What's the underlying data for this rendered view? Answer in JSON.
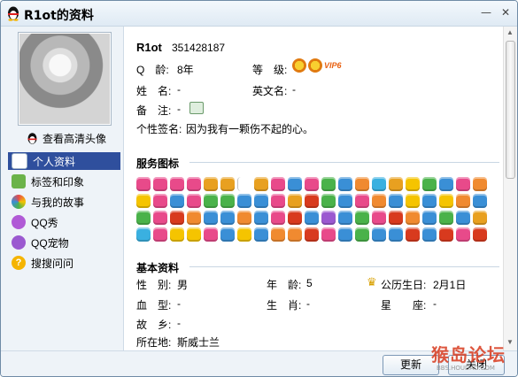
{
  "window": {
    "title": "R1ot的资料",
    "controls": [
      "—",
      "✕"
    ]
  },
  "sidebar": {
    "hd_avatar_link": "查看高清头像",
    "items": [
      {
        "label": "个人资料",
        "icon": "profile-card-icon",
        "color": "#ffffff",
        "active": true
      },
      {
        "label": "标签和印象",
        "icon": "tag-icon",
        "color": "#6bb34a",
        "active": false
      },
      {
        "label": "与我的故事",
        "icon": "rainbow-icon",
        "color": "#f0a020",
        "active": false
      },
      {
        "label": "QQ秀",
        "icon": "qq-show-icon",
        "color": "#b05ad6",
        "active": false
      },
      {
        "label": "QQ宠物",
        "icon": "qq-pet-icon",
        "color": "#9b59d0",
        "active": false
      },
      {
        "label": "搜搜问问",
        "icon": "question-icon",
        "color": "#f5b400",
        "active": false
      }
    ]
  },
  "profile": {
    "nickname": "R1ot",
    "qq_number": "351428187",
    "qq_age_label": "Q　龄:",
    "qq_age_value": "8年",
    "level_label": "等　级:",
    "level_badge": "VIP6",
    "name_label": "姓　名:",
    "name_value": "-",
    "english_name_label": "英文名:",
    "english_name_value": "-",
    "remark_label": "备　注:",
    "remark_value": "-",
    "signature_label": "个性签名:",
    "signature_value": "因为我有一颗伤不起的心。"
  },
  "services": {
    "title": "服务图标",
    "icon_colors": [
      "#e84a8a",
      "#e84a8a",
      "#e84a8a",
      "#e84a8a",
      "#e8a020",
      "#e8a020",
      "#ffffff",
      "#e8a020",
      "#e84a8a",
      "#3a8fd6",
      "#e84a8a",
      "#4ab24a",
      "#3a8fd6",
      "#f08a30",
      "#3ab0e0",
      "#e8a020",
      "#f5c400",
      "#4ab24a",
      "#3a8fd6",
      "#e84a8a",
      "#f08a30",
      "#f5c400",
      "#e84a8a",
      "#3a8fd6",
      "#e84a8a",
      "#4ab24a",
      "#4ab24a",
      "#3a8fd6",
      "#3a8fd6",
      "#e84a8a",
      "#e8a020",
      "#d83a1e",
      "#4ab24a",
      "#3a8fd6",
      "#e84a8a",
      "#f08a30",
      "#3a8fd6",
      "#f5c400",
      "#3a8fd6",
      "#f5c400",
      "#f08a30",
      "#3a8fd6",
      "#4ab24a",
      "#e84a8a",
      "#d83a1e",
      "#f08a30",
      "#3a8fd6",
      "#3a8fd6",
      "#f08a30",
      "#3a8fd6",
      "#e84a8a",
      "#d83a1e",
      "#3a8fd6",
      "#9b59d0",
      "#3a8fd6",
      "#4ab24a",
      "#e84a8a",
      "#d83a1e",
      "#f08a30",
      "#3a8fd6",
      "#4ab24a",
      "#3a8fd6",
      "#e8a020",
      "#3ab0e0",
      "#e84a8a",
      "#f5c400",
      "#f5c400",
      "#e84a8a",
      "#3a8fd6",
      "#f5c400",
      "#3a8fd6",
      "#f08a30",
      "#f08a30",
      "#d83a1e",
      "#e84a8a",
      "#3a8fd6",
      "#4ab24a",
      "#3a8fd6",
      "#3a8fd6",
      "#d83a1e",
      "#3a8fd6",
      "#d83a1e",
      "#e84a8a",
      "#d83a1e"
    ]
  },
  "basic": {
    "title": "基本资料",
    "gender_label": "性　别:",
    "gender_value": "男",
    "age_label": "年　龄:",
    "age_value": "5",
    "birthday_label": "公历生日:",
    "birthday_value": "2月1日",
    "blood_label": "血　型:",
    "blood_value": "-",
    "zodiac_label": "生　肖:",
    "zodiac_value": "-",
    "constellation_label": "星　　座:",
    "constellation_value": "-",
    "hometown_label": "故　乡:",
    "hometown_value": "-",
    "location_label": "所在地:",
    "location_value": "斯威士兰"
  },
  "footer": {
    "update_button": "更新",
    "close_button": "关闭"
  },
  "watermark": {
    "text": "猴岛论坛",
    "url": "BBS.HOUDAO.COM"
  }
}
